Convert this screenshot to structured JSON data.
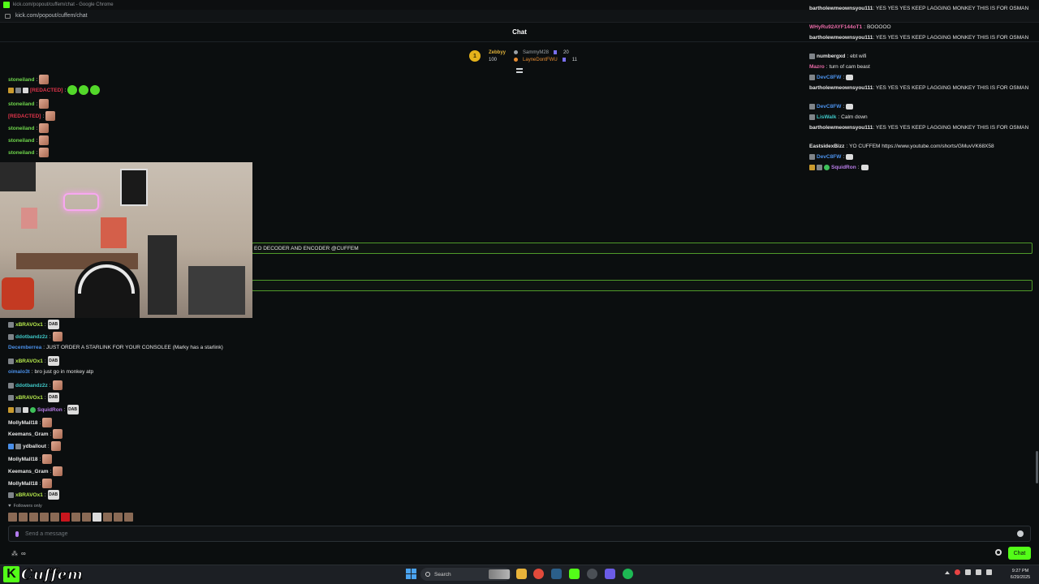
{
  "browser": {
    "title": "kick.com/popout/cuffem/chat - Google Chrome",
    "url": "kick.com/popout/cuffem/chat"
  },
  "chat": {
    "title": "Chat"
  },
  "leaderboard": {
    "first_rank": "1",
    "first_name": "Zebbyy",
    "first_value": "100",
    "second_name": "SammyM28",
    "second_value": "20",
    "third_name": "LayneDontFWU",
    "third_value": "11"
  },
  "left_messages": [
    {
      "user": "stoneiland",
      "color": "u-green",
      "text": ""
    },
    {
      "user": "[REDACTED]",
      "color": "u-red",
      "text": ""
    },
    {
      "user": "stoneiland",
      "color": "u-green",
      "text": ""
    },
    {
      "user": "[REDACTED]",
      "color": "u-red",
      "text": ""
    },
    {
      "user": "stoneiland",
      "color": "u-green",
      "text": ""
    },
    {
      "user": "stoneiland",
      "color": "u-green",
      "text": ""
    },
    {
      "user": "stoneiland",
      "color": "u-green",
      "text": ""
    }
  ],
  "highlight": {
    "text_1": "EO DECODER AND ENCODER @CUFFEM",
    "text_2": ""
  },
  "lower_messages": [
    {
      "user": "xBRAVOx1",
      "color": "u-lime",
      "text": "",
      "emote": "DAB"
    },
    {
      "user": "ddotbandz2z",
      "color": "u-teal",
      "text": ""
    },
    {
      "user": "Decemberrea",
      "color": "u-blue",
      "text": "JUST ORDER A STARLINK FOR YOUR CONSOLEE (Marky has a starlink)"
    },
    {
      "user": "xBRAVOx1",
      "color": "u-lime",
      "text": "",
      "emote": "DAB"
    },
    {
      "user": "oimalo3t",
      "color": "u-blue",
      "text": "bro just go in monkey atp"
    },
    {
      "user": "ddotbandz2z",
      "color": "u-teal",
      "text": ""
    },
    {
      "user": "xBRAVOx1",
      "color": "u-lime",
      "text": "",
      "emote": "DAB"
    },
    {
      "user": "SquidRon",
      "color": "u-purple",
      "text": "",
      "emote": "DAB"
    },
    {
      "user": "MollyMall18",
      "color": "u-white",
      "text": ""
    },
    {
      "user": "Keemans_Gram",
      "color": "u-white",
      "text": ""
    },
    {
      "user": "ydballout",
      "color": "u-white",
      "text": ""
    },
    {
      "user": "MollyMall18",
      "color": "u-white",
      "text": ""
    },
    {
      "user": "Keemans_Gram",
      "color": "u-white",
      "text": ""
    },
    {
      "user": "MollyMall18",
      "color": "u-white",
      "text": ""
    },
    {
      "user": "xBRAVOx1",
      "color": "u-lime",
      "text": "",
      "emote": "DAB"
    }
  ],
  "right_messages": [
    {
      "user": "bartholewmeownsyou111",
      "color": "u-white",
      "text": "YES YES YES KEEP LAGGING MONKEY THIS IS FOR OSMAN"
    },
    {
      "user": "WHyRu92AYF144oT1",
      "color": "u-pink",
      "text": "BOOOOO"
    },
    {
      "user": "bartholewmeownsyou111",
      "color": "u-white",
      "text": "YES YES YES KEEP LAGGING MONKEY THIS IS FOR OSMAN"
    },
    {
      "user": "numbergxd",
      "color": "u-white",
      "text": "ebt wifi"
    },
    {
      "user": "Mazro",
      "color": "u-pink",
      "text": "turn of cam beast"
    },
    {
      "user": "DevC8FW",
      "color": "u-blue",
      "text": ""
    },
    {
      "user": "bartholewmeownsyou111",
      "color": "u-white",
      "text": "YES YES YES KEEP LAGGING MONKEY THIS IS FOR OSMAN"
    },
    {
      "user": "DevC8FW",
      "color": "u-blue",
      "text": ""
    },
    {
      "user": "LisWalk",
      "color": "u-teal",
      "text": "Calm down"
    },
    {
      "user": "bartholewmeownsyou111",
      "color": "u-white",
      "text": "YES YES YES KEEP LAGGING MONKEY THIS IS FOR OSMAN"
    },
    {
      "user": "EastsidexBizz",
      "color": "u-white",
      "text": "YO CUFFEM https://www.youtube.com/shorts/GMuvVK68X58"
    },
    {
      "user": "DevC8FW",
      "color": "u-blue",
      "text": ""
    },
    {
      "user": "SquidRon",
      "color": "u-purple",
      "text": ""
    }
  ],
  "footer": {
    "followers_only": "Followers only",
    "input_placeholder": "Send a message",
    "chat_button": "Chat"
  },
  "taskbar": {
    "logo_text": "Cuffem",
    "search_label": "Search",
    "time": "9:27 PM",
    "date": "6/29/2025"
  },
  "colors": {
    "kick_green": "#53fc18",
    "highlight_border": "#4f9a2a"
  }
}
